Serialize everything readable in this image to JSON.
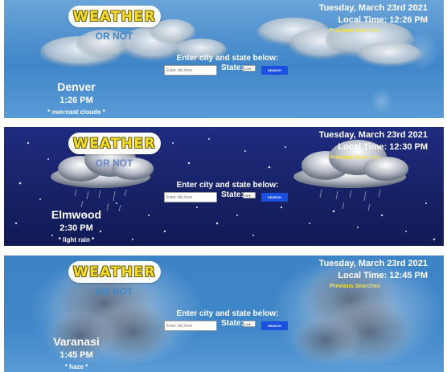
{
  "colors": {
    "logo_fill": "#f3dc2d",
    "previous_searches": "#f2e24a",
    "search_button": "#1a4fe0",
    "panel_sky_light": "#4a8cd0",
    "panel_sky_night": "#1a2570"
  },
  "panels": [
    {
      "logo": "WEATHER",
      "tagline": "OR NOT",
      "date": "Tuesday, March 23rd 2021",
      "local_time": "Local Time: 12:26 PM",
      "previous_searches": "Previous Searches",
      "enter_label": "Enter city and state below:",
      "city_placeholder": "Enter city here",
      "state_label": "State:",
      "state_value": "CO",
      "search_label": "SEARCH",
      "city": "Denver",
      "city_time": "1:26 PM",
      "description": "* overcast clouds *",
      "background_icon": "overcast-cloud-icon"
    },
    {
      "logo": "WEATHER",
      "tagline": "OR NOT",
      "date": "Tuesday, March 23rd 2021",
      "local_time": "Local Time: 12:30 PM",
      "previous_searches": "Previous Searches",
      "enter_label": "Enter city and state below:",
      "city_placeholder": "Enter city here",
      "state_label": "State:",
      "state_value": "NE",
      "search_label": "SEARCH",
      "city": "Elmwood",
      "city_time": "2:30 PM",
      "description": "* light rain *",
      "background_icon": "rain-cloud-icon"
    },
    {
      "logo": "WEATHER",
      "tagline": "OR NOT",
      "date": "Tuesday, March 23rd 2021",
      "local_time": "Local Time: 12:45 PM",
      "previous_searches": "Previous Searches",
      "enter_label": "Enter city and state below:",
      "city_placeholder": "Enter city here",
      "state_label": "State:",
      "state_value": "CA",
      "search_label": "SEARCH",
      "city": "Varanasi",
      "city_time": "1:45 PM",
      "description": "* haze *",
      "background_icon": "haze-smoke-icon"
    }
  ]
}
